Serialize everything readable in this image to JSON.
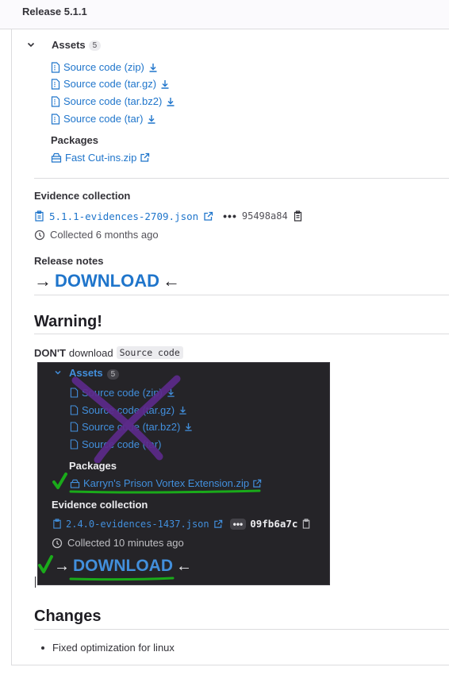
{
  "release": {
    "title": "Release 5.1.1"
  },
  "assets": {
    "label": "Assets",
    "count": "5",
    "sources": [
      {
        "label": "Source code (zip)"
      },
      {
        "label": "Source code (tar.gz)"
      },
      {
        "label": "Source code (tar.bz2)"
      },
      {
        "label": "Source code (tar)"
      }
    ],
    "packages_label": "Packages",
    "packages": [
      {
        "label": "Fast Cut-ins.zip"
      }
    ]
  },
  "evidence": {
    "label": "Evidence collection",
    "file": "5.1.1-evidences-2709.json",
    "dots": "•••",
    "sha": "95498a84",
    "collected": "Collected 6 months ago"
  },
  "notes": {
    "label": "Release notes",
    "arrow_right": "→",
    "download": "DOWNLOAD",
    "arrow_left": "←",
    "warning": "Warning!",
    "dont": "DON'T",
    "download_word": "download",
    "source_code_chip": "Source code"
  },
  "embedded": {
    "assets_label": "Assets",
    "assets_count": "5",
    "sources": [
      "Source code (zip)",
      "Source code (tar.gz)",
      "Source code (tar.bz2)",
      "Source code (tar)"
    ],
    "packages_label": "Packages",
    "package": "Karryn's Prison Vortex Extension.zip",
    "evidence_label": "Evidence collection",
    "evidence_file": "2.4.0-evidences-1437.json",
    "dots": "•••",
    "sha": "09fb6a7c",
    "collected": "Collected 10 minutes ago",
    "download": "DOWNLOAD",
    "arrow_right": "→",
    "arrow_left": "←"
  },
  "changes": {
    "title": "Changes",
    "items": [
      "Fixed optimization for linux"
    ]
  },
  "colors": {
    "link": "#1f75cb",
    "dark_bg": "#252428",
    "check_green": "#1aaa1a",
    "cross_purple": "#5b2a8a"
  }
}
